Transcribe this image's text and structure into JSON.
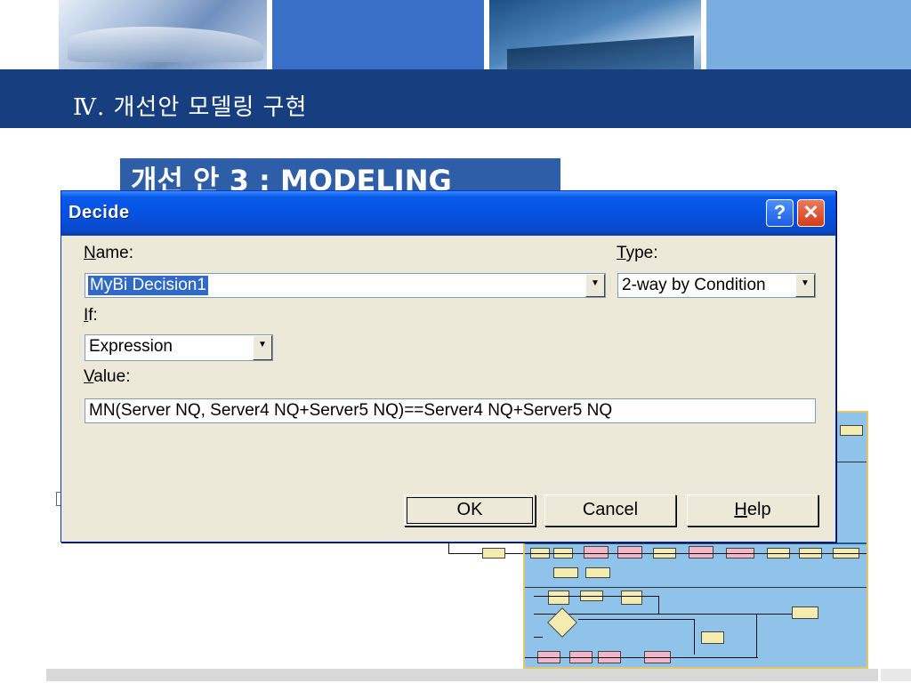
{
  "slide": {
    "title": "Ⅳ. 개선안 모델링 구현",
    "subtitle": "개선 안 3 : MODELING"
  },
  "dialog": {
    "title": "Decide",
    "help_button": "?",
    "close_button": "✕",
    "name_label": "Name:",
    "name_value": "MyBi Decision1",
    "type_label": "Type:",
    "type_value": "2-way by Condition",
    "if_label": "If:",
    "if_value": "Expression",
    "value_label": "Value:",
    "value_text": "MN(Server NQ, Server4 NQ+Server5 NQ)==Server4 NQ+Server5 NQ",
    "ok_label": "OK",
    "cancel_label": "Cancel",
    "help_label": "Help"
  },
  "icons": {
    "dropdown": "▼"
  },
  "colors": {
    "title_band": "#173e7e",
    "subtitle_box": "#2e5ea8",
    "titlebar": "#0552e2",
    "selection": "#316ac5",
    "flowchart_bg": "#8fc3ea"
  }
}
